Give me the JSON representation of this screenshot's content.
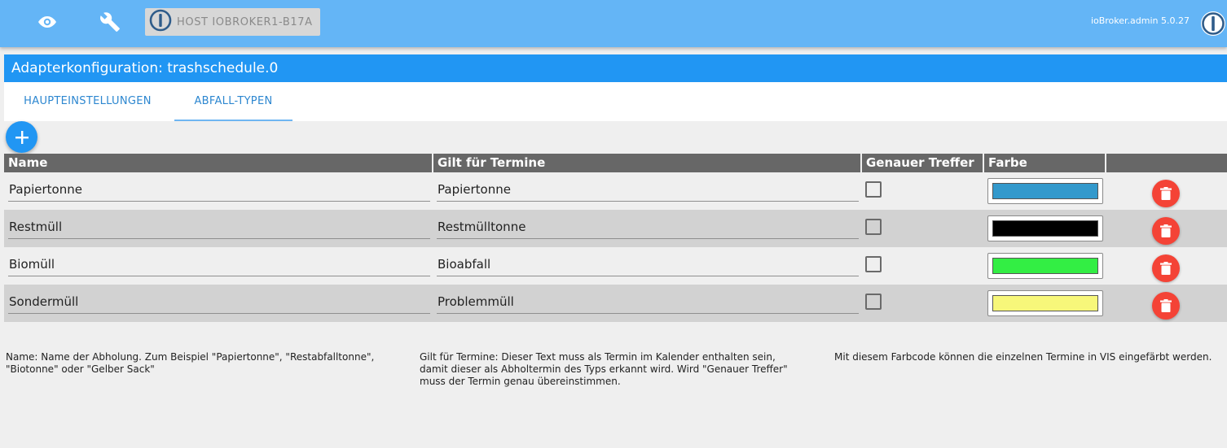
{
  "header": {
    "host_label": "HOST IOBROKER1-B17A",
    "version": "ioBroker.admin 5.0.27",
    "icons": [
      "eye-icon",
      "wrench-icon",
      "iobroker-logo-icon"
    ]
  },
  "title": "Adapterkonfiguration: trashschedule.0",
  "tabs": [
    {
      "label": "HAUPTEINSTELLUNGEN",
      "active": false
    },
    {
      "label": "ABFALL-TYPEN",
      "active": true
    }
  ],
  "table": {
    "columns": [
      "Name",
      "Gilt für Termine",
      "Genauer Treffer",
      "Farbe",
      ""
    ],
    "rows": [
      {
        "name": "Papiertonne",
        "match": "Papiertonne",
        "exact": false,
        "color": "#3399cc"
      },
      {
        "name": "Restmüll",
        "match": "Restmülltonne",
        "exact": false,
        "color": "#000000"
      },
      {
        "name": "Biomüll",
        "match": "Bioabfall",
        "exact": false,
        "color": "#33ee44"
      },
      {
        "name": "Sondermüll",
        "match": "Problemmüll",
        "exact": false,
        "color": "#f7f77a"
      }
    ]
  },
  "help": {
    "name": "Name: Name der Abholung. Zum Beispiel \"Papiertonne\", \"Restabfalltonne\", \"Biotonne\" oder \"Gelber Sack\"",
    "match": "Gilt für Termine: Dieser Text muss als Termin im Kalender enthalten sein, damit dieser als Abholtermin des Typs erkannt wird. Wird \"Genauer Treffer\" muss der Termin genau übereinstimmen.",
    "color": "Mit diesem Farbcode können die einzelnen Termine in VIS eingefärbt werden."
  },
  "colors": {
    "topbar": "#64b5f6",
    "titlebar": "#2196f3",
    "accent": "#2196f3",
    "delete": "#f44336",
    "table_header": "#676767"
  }
}
